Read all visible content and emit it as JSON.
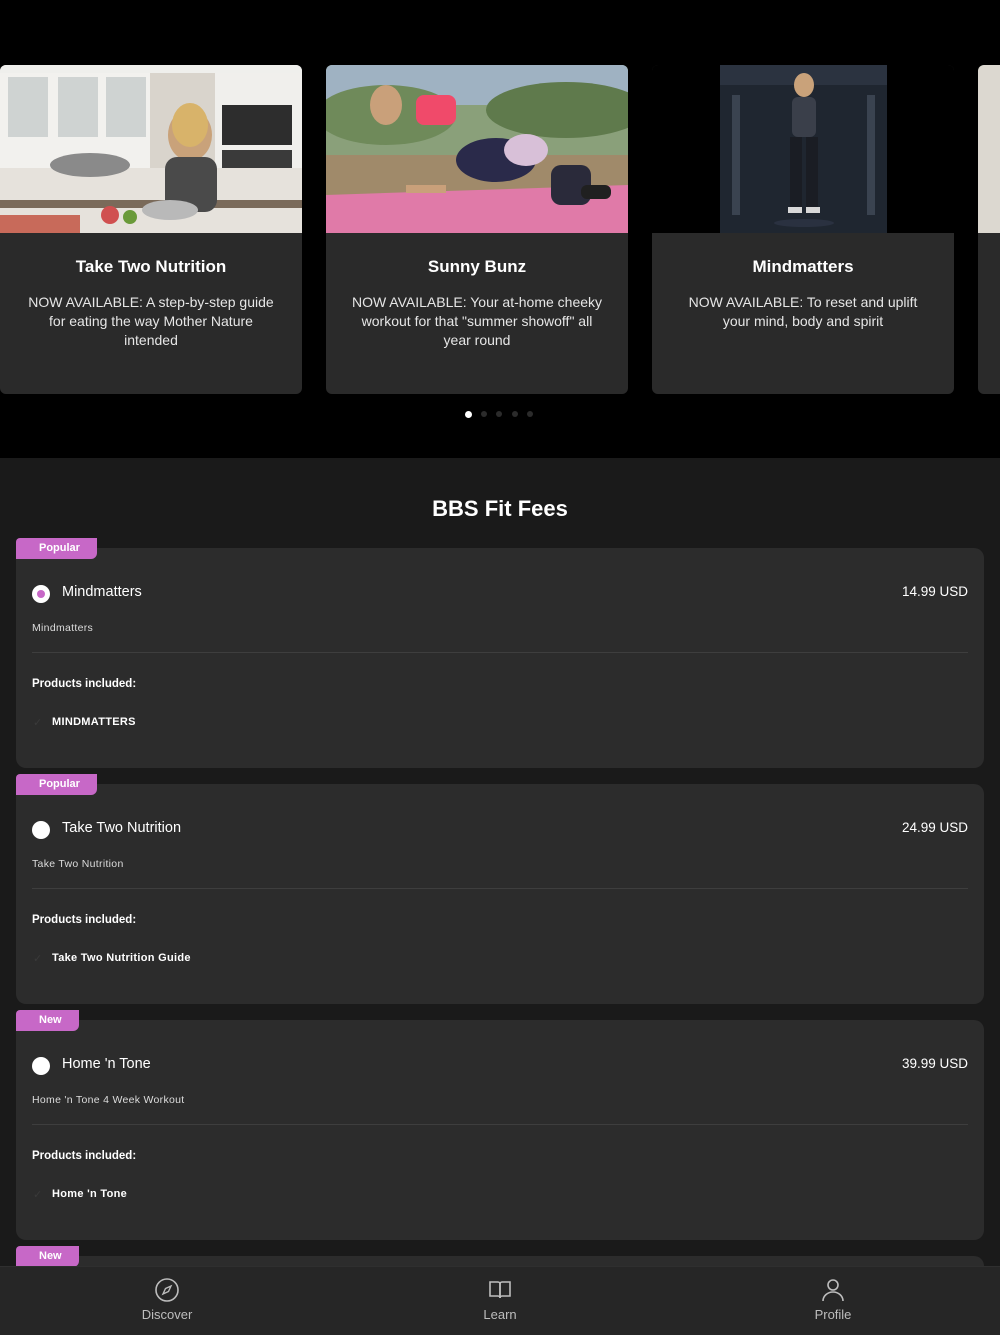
{
  "carousel": {
    "cards": [
      {
        "title": "Take Two Nutrition",
        "description": "NOW AVAILABLE: A step-by-step guide for eating the way Mother Nature intended"
      },
      {
        "title": "Sunny Bunz",
        "description": "NOW AVAILABLE: Your at-home cheeky workout for that \"summer showoff\" all year round"
      },
      {
        "title": "Mindmatters",
        "description": "NOW AVAILABLE: To reset and uplift your mind, body and spirit"
      }
    ],
    "active_page": 1,
    "page_count": 5
  },
  "fees": {
    "title": "BBS Fit Fees",
    "included_label": "Products included:",
    "plans": [
      {
        "badge": "Popular",
        "name": "Mindmatters",
        "price": "14.99 USD",
        "subtitle": "Mindmatters",
        "product": "MINDMATTERS",
        "selected": true
      },
      {
        "badge": "Popular",
        "name": "Take Two Nutrition",
        "price": "24.99 USD",
        "subtitle": "Take Two Nutrition",
        "product": "Take Two Nutrition Guide",
        "selected": false
      },
      {
        "badge": "New",
        "name": "Home 'n Tone",
        "price": "39.99 USD",
        "subtitle": "Home 'n Tone 4 Week Workout",
        "product": "Home 'n Tone",
        "selected": false
      },
      {
        "badge": "New"
      }
    ]
  },
  "nav": {
    "discover": "Discover",
    "learn": "Learn",
    "profile": "Profile"
  },
  "colors": {
    "accent": "#c768c7",
    "card_bg": "#2c2c2c",
    "page_bg": "#1a1a1a"
  }
}
